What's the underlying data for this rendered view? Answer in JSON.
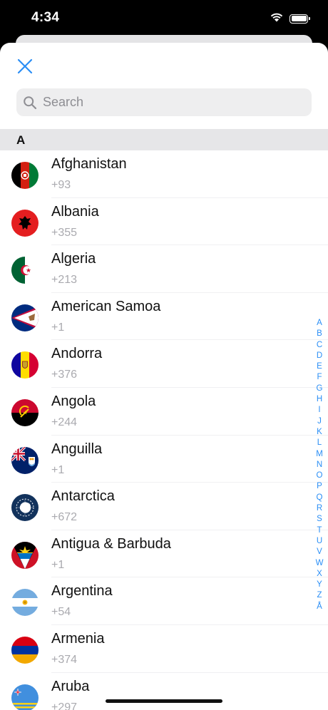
{
  "status_bar": {
    "time": "4:34"
  },
  "search": {
    "placeholder": "Search"
  },
  "section": {
    "header": "A"
  },
  "countries": [
    {
      "name": "Afghanistan",
      "code": "+93",
      "flag": "afghanistan-flag"
    },
    {
      "name": "Albania",
      "code": "+355",
      "flag": "albania-flag"
    },
    {
      "name": "Algeria",
      "code": "+213",
      "flag": "algeria-flag"
    },
    {
      "name": "American Samoa",
      "code": "+1",
      "flag": "american-samoa-flag"
    },
    {
      "name": "Andorra",
      "code": "+376",
      "flag": "andorra-flag"
    },
    {
      "name": "Angola",
      "code": "+244",
      "flag": "angola-flag"
    },
    {
      "name": "Anguilla",
      "code": "+1",
      "flag": "anguilla-flag"
    },
    {
      "name": "Antarctica",
      "code": "+672",
      "flag": "antarctica-flag"
    },
    {
      "name": "Antigua & Barbuda",
      "code": "+1",
      "flag": "antigua-barbuda-flag"
    },
    {
      "name": "Argentina",
      "code": "+54",
      "flag": "argentina-flag"
    },
    {
      "name": "Armenia",
      "code": "+374",
      "flag": "armenia-flag"
    },
    {
      "name": "Aruba",
      "code": "+297",
      "flag": "aruba-flag"
    }
  ],
  "index_letters": [
    "A",
    "B",
    "C",
    "D",
    "E",
    "F",
    "G",
    "H",
    "I",
    "J",
    "K",
    "L",
    "M",
    "N",
    "O",
    "P",
    "Q",
    "R",
    "S",
    "T",
    "U",
    "V",
    "W",
    "X",
    "Y",
    "Z",
    "Å"
  ],
  "colors": {
    "accent": "#2a8ef5",
    "section_bg": "#e6e6e8",
    "search_bg": "#eeeeef"
  }
}
